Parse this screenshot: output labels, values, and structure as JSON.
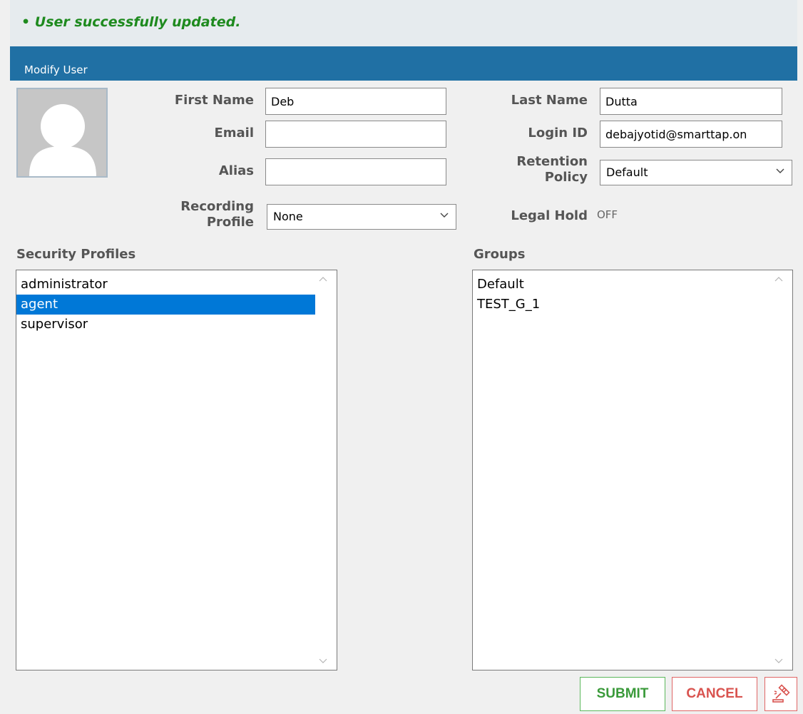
{
  "status": {
    "message": "User successfully updated.",
    "bullet": "•"
  },
  "panel": {
    "title": "Modify User"
  },
  "form": {
    "first_name_label": "First Name",
    "first_name_value": "Deb",
    "last_name_label": "Last Name",
    "last_name_value": "Dutta",
    "email_label": "Email",
    "email_value": "",
    "login_id_label": "Login ID",
    "login_id_value": "debajyotid@smarttap.on",
    "alias_label": "Alias",
    "alias_value": "",
    "retention_label_line1": "Retention",
    "retention_label_line2": "Policy",
    "retention_value": "Default",
    "recording_label_line1": "Recording",
    "recording_label_line2": "Profile",
    "recording_value": "None",
    "legal_hold_label": "Legal Hold",
    "legal_hold_value": "OFF"
  },
  "security_profiles": {
    "title": "Security Profiles",
    "items": [
      "administrator",
      "agent",
      "supervisor"
    ],
    "selected": "agent"
  },
  "groups": {
    "title": "Groups",
    "items": [
      "Default",
      "TEST_G_1"
    ]
  },
  "buttons": {
    "submit": "SUBMIT",
    "cancel": "CANCEL"
  },
  "colors": {
    "header_bg": "#2070a4",
    "success_text": "#1e8a1e",
    "selection": "#0078d7",
    "submit": "#3a9a3a",
    "cancel": "#d9534f"
  }
}
